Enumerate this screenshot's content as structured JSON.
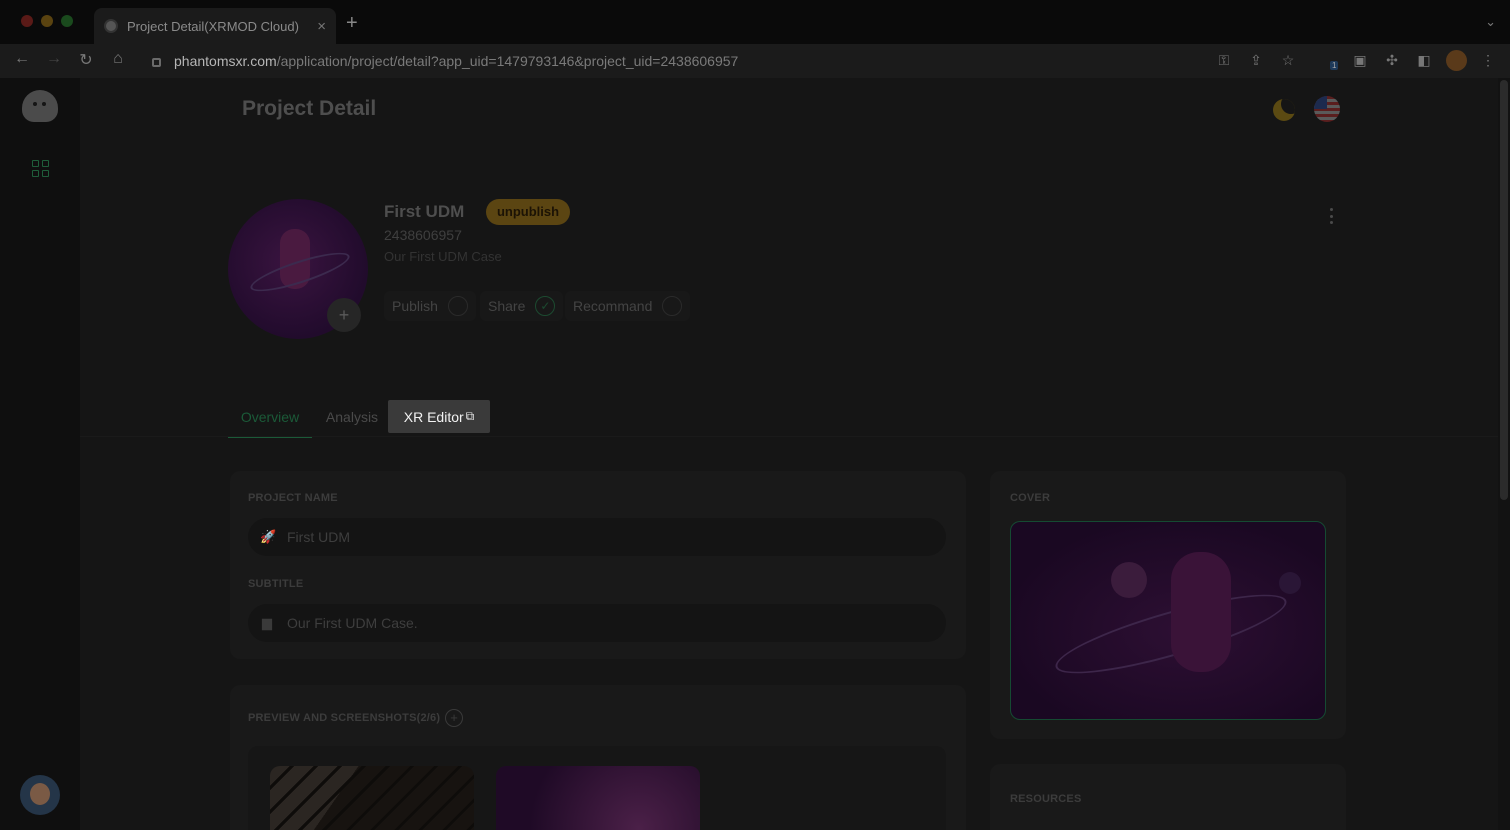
{
  "browser": {
    "tab_title": "Project Detail(XRMOD Cloud)",
    "tab_close_icon": "×",
    "new_tab_icon": "+",
    "url_host": "phantomsxr.com",
    "url_path": "/application/project/detail?app_uid=1479793146&project_uid=2438606957",
    "extension_badge": "1"
  },
  "page": {
    "title": "Project Detail"
  },
  "project": {
    "name": "First UDM",
    "status_badge": "unpublish",
    "id": "2438606957",
    "subtitle_header": "Our First UDM Case",
    "avatar_add": "+",
    "toggles": [
      {
        "label": "Publish",
        "checked": false
      },
      {
        "label": "Share",
        "checked": true,
        "check_glyph": "✓"
      },
      {
        "label": "Recommand",
        "checked": false
      }
    ]
  },
  "tabs": {
    "overview": "Overview",
    "analysis": "Analysis",
    "xr_editor": "XR Editor"
  },
  "form": {
    "project_name_label": "PROJECT NAME",
    "project_name_value": "First UDM",
    "subtitle_label": "SUBTITLE",
    "subtitle_value": "Our First UDM Case."
  },
  "preview": {
    "label": "PREVIEW AND SCREENSHOTS(2/6)",
    "add_icon": "+"
  },
  "cover": {
    "label": "COVER"
  },
  "resources": {
    "label": "RESOURCES"
  },
  "colors": {
    "accent_green": "#1b5a38",
    "badge_orange": "#5b4512",
    "overlay": "#151515"
  }
}
